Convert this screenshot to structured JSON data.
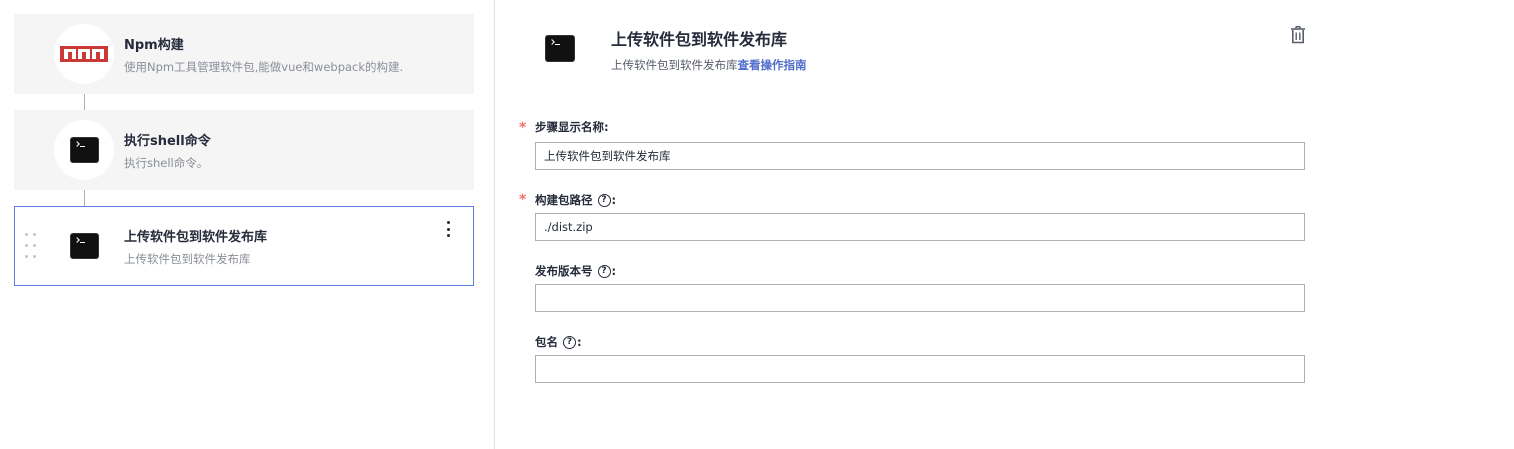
{
  "steps": [
    {
      "title": "Npm构建",
      "desc": "使用Npm工具管理软件包,能做vue和webpack的构建.",
      "icon": "npm-logo-icon"
    },
    {
      "title": "执行shell命令",
      "desc": "执行shell命令。",
      "icon": "terminal-icon"
    },
    {
      "title": "上传软件包到软件发布库",
      "desc": "上传软件包到软件发布库",
      "icon": "terminal-icon",
      "active": true
    }
  ],
  "detail": {
    "title": "上传软件包到软件发布库",
    "subtitle": "上传软件包到软件发布库",
    "guide_link": "查看操作指南",
    "delete_icon": "trash-icon"
  },
  "form": {
    "display_name": {
      "label": "步骤显示名称:",
      "value": "上传软件包到软件发布库",
      "required": "*"
    },
    "build_path": {
      "label": "构建包路径",
      "value": "./dist.zip",
      "required": "*",
      "colon": ":"
    },
    "version": {
      "label": "发布版本号",
      "value": "",
      "colon": ":"
    },
    "package_name": {
      "label": "包名",
      "value": "",
      "colon": ":"
    },
    "help_glyph": "?"
  },
  "colors": {
    "accent": "#5e7ce0",
    "link": "#526ecc",
    "required": "#f66f6a",
    "npm_red": "#cb3837"
  }
}
